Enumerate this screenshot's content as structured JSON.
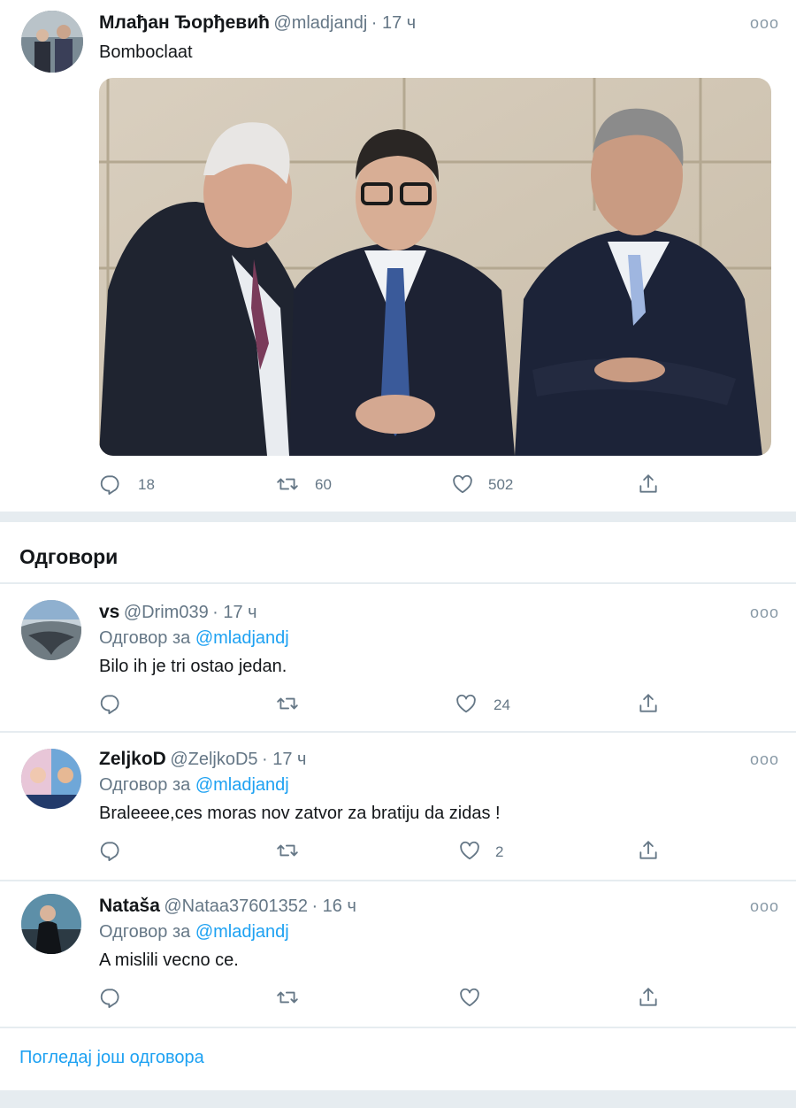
{
  "main_tweet": {
    "name": "Млађан Ђорђевић",
    "handle": "@mladjandj",
    "time": "· 17 ч",
    "text": "Bomboclaat",
    "stats": {
      "replies": "18",
      "retweets": "60",
      "likes": "502"
    }
  },
  "replies_section": {
    "title": "Одговори"
  },
  "replies": [
    {
      "name": "vs",
      "handle": "@Drim039",
      "time": "· 17 ч",
      "reply_prefix": "Одговор за",
      "reply_to": "@mladjandj",
      "text": "Bilo ih je tri ostao jedan.",
      "likes": "24"
    },
    {
      "name": "ZeljkoD",
      "handle": "@ZeljkoD5",
      "time": "· 17 ч",
      "reply_prefix": "Одговор за",
      "reply_to": "@mladjandj",
      "text": "Braleeee,ces moras nov zatvor za bratiju da zidas !",
      "likes": "2"
    },
    {
      "name": "Nataša",
      "handle": "@Nataa37601352",
      "time": "· 16 ч",
      "reply_prefix": "Одговор за",
      "reply_to": "@mladjandj",
      "text": "A mislili vecno ce.",
      "likes": ""
    }
  ],
  "show_more": "Погледај још одговора",
  "icons": {
    "reply": "reply-icon",
    "retweet": "retweet-icon",
    "like": "heart-icon",
    "share": "share-icon",
    "more": "more-icon"
  },
  "colors": {
    "link": "#1da1f2",
    "secondary": "#657786",
    "separator": "#e6ecf0"
  }
}
